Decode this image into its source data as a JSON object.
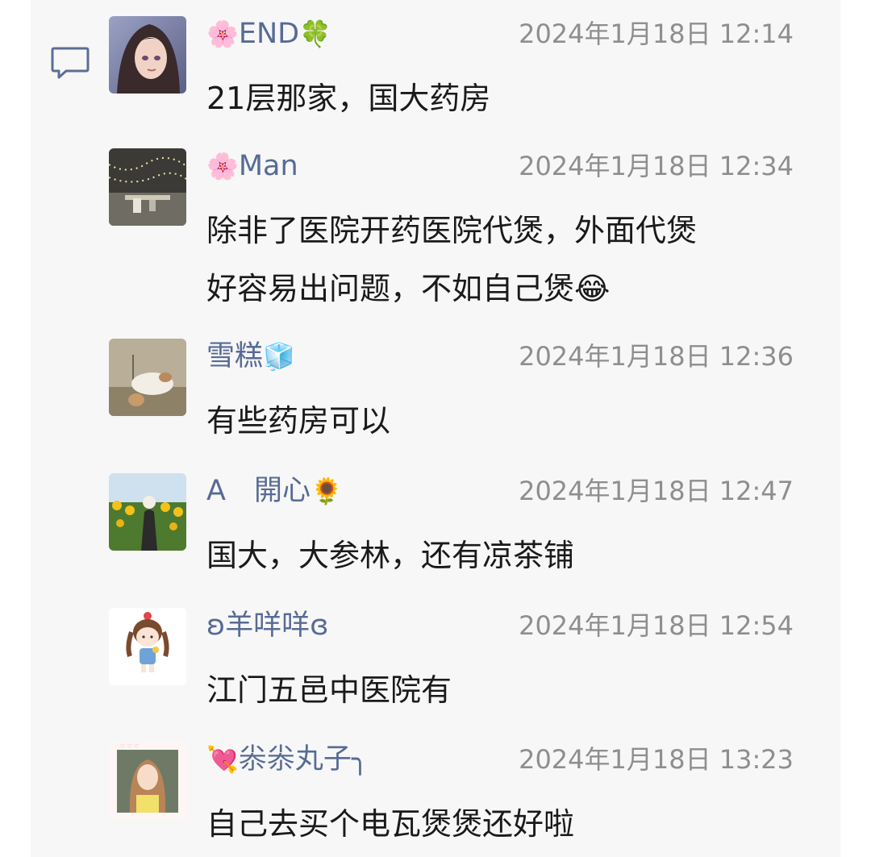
{
  "comments": [
    {
      "nick_prefix": "🌸",
      "nick": "END",
      "nick_suffix": "🍀",
      "time": "2024年1月18日 12:14",
      "text": "21层那家，国大药房",
      "text_suffix": "",
      "avatar_icon": "anime-girl-avatar"
    },
    {
      "nick_prefix": "🌸",
      "nick": "Man",
      "nick_suffix": "",
      "time": "2024年1月18日 12:34",
      "text": "除非了医院开药医院代煲，外面代煲\n好容易出问题，不如自己煲",
      "text_suffix": "😂",
      "avatar_icon": "string-lights-photo-avatar"
    },
    {
      "nick_prefix": "",
      "nick": "雪糕",
      "nick_suffix": "🧊",
      "time": "2024年1月18日 12:36",
      "text": "有些药房可以",
      "text_suffix": "",
      "avatar_icon": "dog-photo-avatar"
    },
    {
      "nick_prefix": "",
      "nick": "A　開心",
      "nick_suffix": "🌻",
      "time": "2024年1月18日 12:47",
      "text": "国大，大参林，还有凉茶铺",
      "text_suffix": "",
      "avatar_icon": "sunflower-field-avatar"
    },
    {
      "nick_prefix": "",
      "nick": "ʚ羊咩咩ɞ",
      "nick_suffix": "",
      "time": "2024年1月18日 12:54",
      "text": "江门五邑中医院有",
      "text_suffix": "",
      "avatar_icon": "cartoon-girl-avatar"
    },
    {
      "nick_prefix": "💘",
      "nick": "尜尜丸子╮",
      "nick_suffix": "",
      "time": "2024年1月18日 13:23",
      "text": "自己去买个电瓦煲煲还好啦",
      "text_suffix": "",
      "avatar_icon": "selfie-girl-avatar"
    }
  ],
  "colors": {
    "nickname": "#576b95",
    "timestamp": "#8e8e8e",
    "body_text": "#1a1a1a",
    "panel_bg": "#f7f7f7"
  },
  "icons": {
    "section_icon": "comment-icon"
  }
}
